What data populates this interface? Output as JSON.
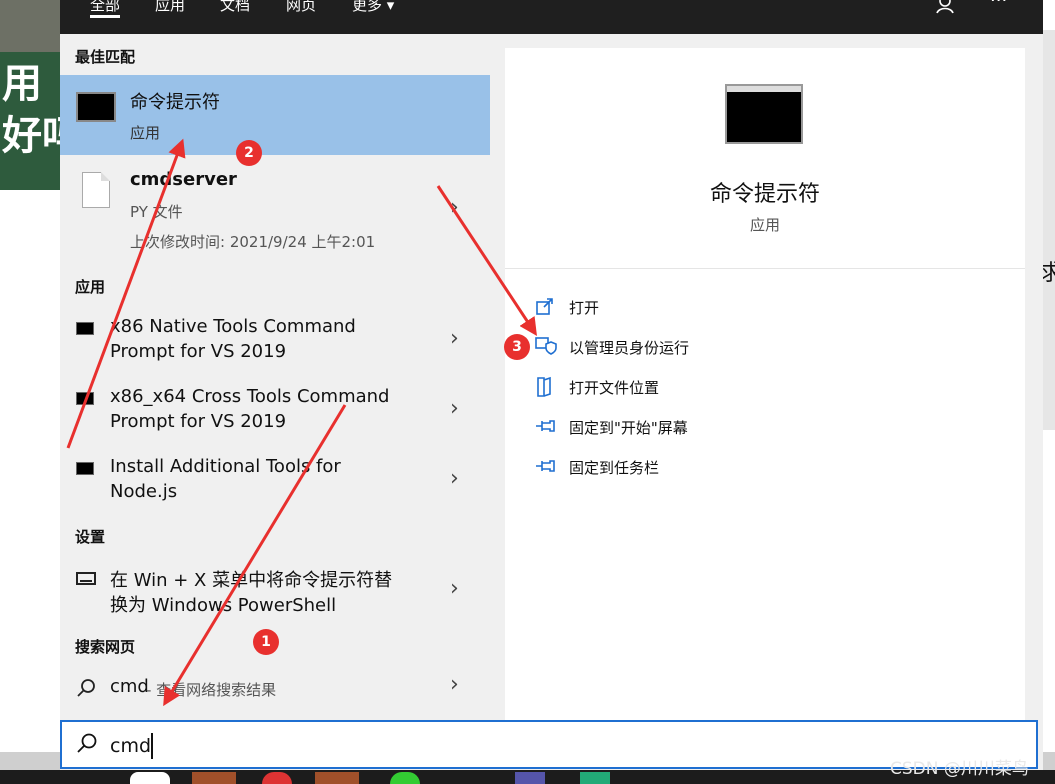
{
  "background": {
    "left_text": "用\n好吗",
    "right_text": "求"
  },
  "topbar": {
    "tabs": [
      "全部",
      "应用",
      "文档",
      "网页",
      "更多"
    ],
    "more_caret": "▾",
    "feedback_icon": "person-feedback-icon",
    "overflow_icon": "ellipsis-icon"
  },
  "best_match": {
    "header": "最佳匹配",
    "title": "命令提示符",
    "subtitle": "应用"
  },
  "file_result": {
    "title": "cmdserver",
    "type": "PY 文件",
    "modified": "上次修改时间: 2021/9/24 上午2:01"
  },
  "apps": {
    "header": "应用",
    "items": [
      {
        "line1": "x86 Native Tools Command",
        "line2": "Prompt for VS 2019"
      },
      {
        "line1": "x86_x64 Cross Tools Command",
        "line2": "Prompt for VS 2019"
      },
      {
        "line1": "Install Additional Tools for",
        "line2": "Node.js"
      }
    ]
  },
  "settings": {
    "header": "设置",
    "line1": "在 Win + X 菜单中将命令提示符替",
    "line2": "换为 Windows PowerShell"
  },
  "web": {
    "header": "搜索网页",
    "query": "cmd",
    "hint": " - 查看网络搜索结果"
  },
  "preview": {
    "title": "命令提示符",
    "subtitle": "应用"
  },
  "actions": [
    {
      "label": "打开",
      "icon": "open-icon"
    },
    {
      "label": "以管理员身份运行",
      "icon": "shield-admin-icon"
    },
    {
      "label": "打开文件位置",
      "icon": "folder-location-icon"
    },
    {
      "label": "固定到\"开始\"屏幕",
      "icon": "pin-start-icon"
    },
    {
      "label": "固定到任务栏",
      "icon": "pin-taskbar-icon"
    }
  ],
  "search": {
    "value": "cmd"
  },
  "annotations": {
    "badge1": "1",
    "badge2": "2",
    "badge3": "3",
    "color": "#e8302e"
  },
  "watermark": "CSDN @川川菜鸟",
  "colors": {
    "selected": "#99c1e8",
    "accent": "#1f6fd1",
    "topbar": "#1f1f1f"
  }
}
